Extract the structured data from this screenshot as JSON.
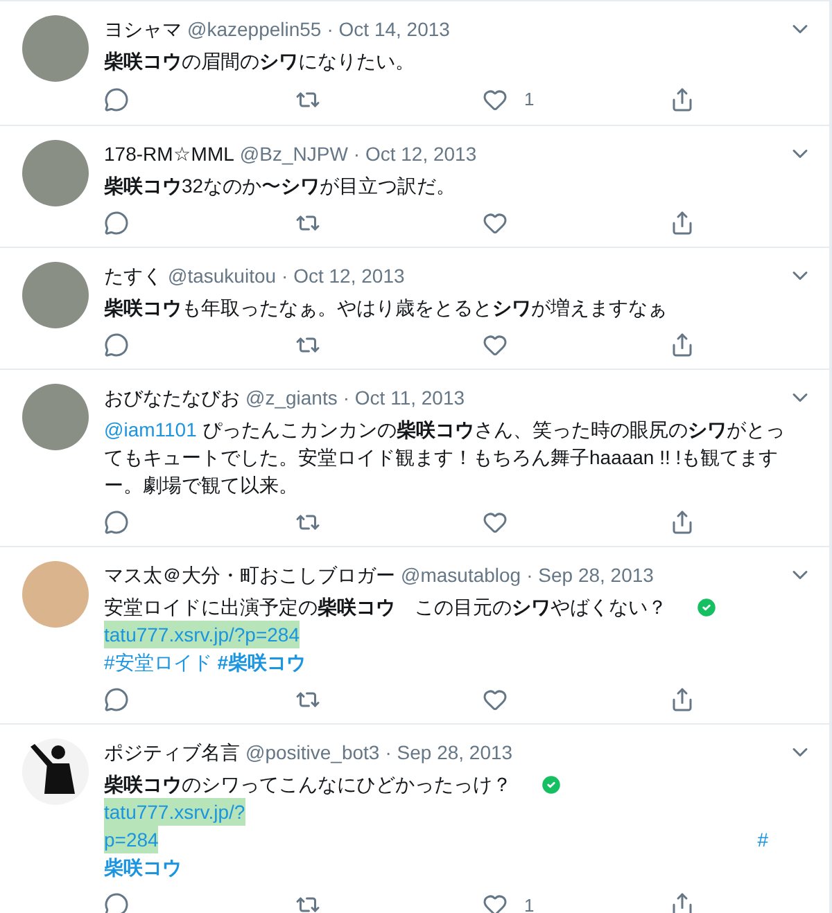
{
  "tweets": [
    {
      "avatar": {
        "kind": "photo"
      },
      "name": "ヨシャマ",
      "handle": "@kazeppelin55",
      "date": "· Oct 14, 2013",
      "lines": [
        [
          {
            "kind": "text",
            "text": "**柴咲コウ**の眉間の**シワ**になりたい。"
          }
        ]
      ],
      "likes": "1"
    },
    {
      "avatar": {
        "kind": "photo"
      },
      "name": "178-RM☆MML",
      "handle": "@Bz_NJPW",
      "date": "· Oct 12, 2013",
      "lines": [
        [
          {
            "kind": "text",
            "text": "**柴咲コウ**32なのか〜**シワ**が目立つ訳だ。"
          }
        ]
      ]
    },
    {
      "avatar": {
        "kind": "photo"
      },
      "name": "たすく",
      "handle": "@tasukuitou",
      "date": "· Oct 12, 2013",
      "lines": [
        [
          {
            "kind": "text",
            "text": "**柴咲コウ**も年取ったなぁ。やはり歳をとると**シワ**が増えますなぁ"
          }
        ]
      ]
    },
    {
      "avatar": {
        "kind": "photo"
      },
      "name": "おびなたなびお",
      "handle": "@z_giants",
      "date": "· Oct 11, 2013",
      "lines": [
        [
          {
            "kind": "mention",
            "text": "@iam1101"
          },
          {
            "kind": "text",
            "text": " ぴったんこカンカンの**柴咲コウ**さん、笑った時の眼尻の**シワ**がとってもキュートでした。安堂ロイド観ます！もちろん舞子haaaan !! !も観てますー。劇場で観て以来。"
          }
        ]
      ]
    },
    {
      "avatar": {
        "kind": "cartoon"
      },
      "name": "マス太＠大分・町おこしブロガー",
      "handle": "@masutablog",
      "date": "· Sep 28, 2013",
      "lines": [
        [
          {
            "kind": "text",
            "text": "安堂ロイドに出演予定の**柴咲コウ**　この目元の**シワ**やばくない？"
          },
          {
            "kind": "check"
          }
        ],
        [
          {
            "kind": "link",
            "text": "tatu777.xsrv.jp/?p=284"
          }
        ],
        [
          {
            "kind": "hashtag",
            "text": "#安堂ロイド"
          },
          {
            "kind": "hashtag",
            "text": "**#柴咲コウ**"
          }
        ]
      ]
    },
    {
      "avatar": {
        "kind": "silhouette"
      },
      "name": "ポジティブ名言",
      "handle": "@positive_bot3",
      "date": "· Sep 28, 2013",
      "lines": [
        [
          {
            "kind": "text",
            "text": "**柴咲コウ**のシワってこんなにひどかったっけ？"
          },
          {
            "kind": "check"
          }
        ],
        [
          {
            "kind": "link",
            "text": "tatu777.xsrv.jp/?"
          }
        ],
        [
          {
            "kind": "link",
            "text": "p=284"
          },
          {
            "kind": "hashtag",
            "text": "#"
          }
        ],
        [
          {
            "kind": "hashtag",
            "text": "**柴咲コウ**"
          }
        ]
      ],
      "likes": "1"
    }
  ]
}
